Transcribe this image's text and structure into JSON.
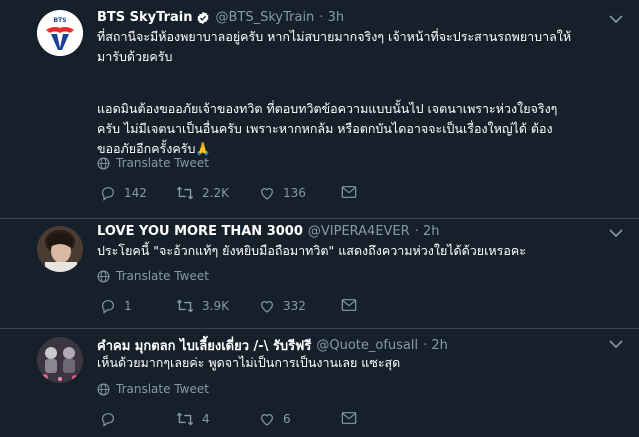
{
  "tweets": [
    {
      "name": "BTS SkyTrain",
      "handle": "@BTS_SkyTrain",
      "time": "· 3h",
      "verified": true,
      "logo_text": "BTS",
      "body": [
        "ที่สถานีจะมีห้องพยาบาลอยู่ครับ หากไม่สบายมากจริงๆ เจ้าหน้าที่จะประสานรถพยาบาลให้",
        "มารับด้วยครับ",
        "",
        "แอดมินต้องขออภัยเจ้าของทวิต ที่ตอบทวิตข้อความแบบนั้นไป เจตนาเพราะห่วงใยจริงๆ",
        "ครับ ไม่มีเจตนาเป็นอื่นครับ เพราะหากหกล้ม หรือตกบันไดอาจจะเป็นเรื่องใหญ่ได้ ต้อง",
        "ขออภัยอีกครั้งครับ🙏"
      ],
      "translate": "Translate Tweet",
      "replies": "142",
      "retweets": "2.2K",
      "likes": "136"
    },
    {
      "name": "LOVE YOU MORE THAN 3000",
      "handle": "@VIPERA4EVER",
      "time": "· 2h",
      "verified": false,
      "body": [
        "ประโยคนี้ \"จะอ้วกแท้ๆ ยังหยิบมือถือมาทวิต\"  แสดงถึงความห่วงใยได้ด้วยเหรอคะ"
      ],
      "translate": "Translate Tweet",
      "replies": "1",
      "retweets": "3.9K",
      "likes": "332"
    },
    {
      "name": "คำคม มุกตลก ไบเลี้ยงเดี่ยว /-\\ รับรีฟรี",
      "handle": "@Quote_ofusall",
      "time": "· 2h",
      "verified": false,
      "body": [
        "เห็นด้วยมากๆเลยค่ะ พูดจาไม่เป็นการเป็นงานเลย แซะสุด"
      ],
      "translate": "Translate Tweet",
      "replies": "",
      "retweets": "4",
      "likes": "6"
    }
  ],
  "colors": {
    "background": "#15202b",
    "divider": "#38444d",
    "secondary_text": "#8899a6",
    "verified": "#1da1f2",
    "bts_red": "#e42c2c",
    "bts_blue": "#1a3f96"
  },
  "icons": [
    "verified-icon",
    "chevron-down-icon",
    "globe-icon",
    "reply-icon",
    "retweet-icon",
    "like-icon",
    "share-icon"
  ]
}
